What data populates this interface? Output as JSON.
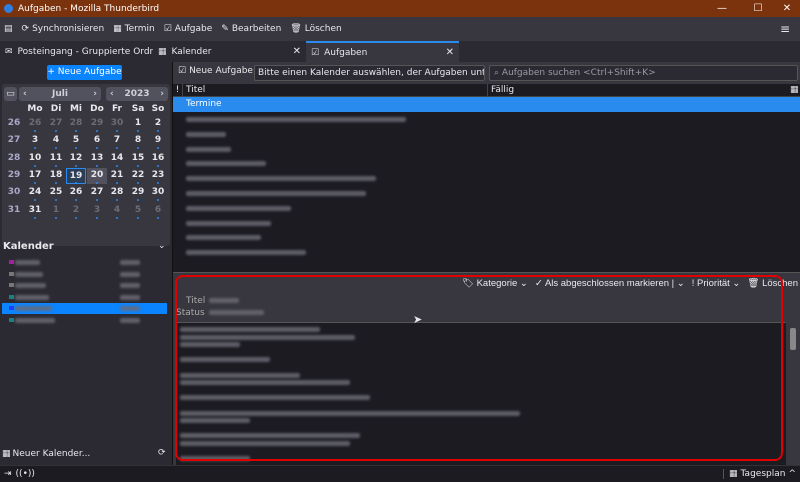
{
  "window": {
    "title": "Aufgaben - Mozilla Thunderbird",
    "minimize": "—",
    "maximize": "☐",
    "close": "✕"
  },
  "toolbar": {
    "sync": "Synchronisieren",
    "event": "Termin",
    "task": "Aufgabe",
    "edit": "Bearbeiten",
    "delete": "Löschen",
    "menu": "≡"
  },
  "tabs": [
    {
      "label": "Posteingang - Gruppierte Ordne"
    },
    {
      "label": "Kalender"
    },
    {
      "label": "Aufgaben"
    }
  ],
  "left": {
    "new_task": "+ Neue Aufgabe",
    "month": "Juli",
    "year": "2023",
    "weekdays": [
      "Mo",
      "Di",
      "Mi",
      "Do",
      "Fr",
      "Sa",
      "So"
    ],
    "weeks": [
      {
        "wk": "26",
        "days": [
          "26",
          "27",
          "28",
          "29",
          "30",
          "1",
          "2"
        ]
      },
      {
        "wk": "27",
        "days": [
          "3",
          "4",
          "5",
          "6",
          "7",
          "8",
          "9"
        ]
      },
      {
        "wk": "28",
        "days": [
          "10",
          "11",
          "12",
          "13",
          "14",
          "15",
          "16"
        ]
      },
      {
        "wk": "29",
        "days": [
          "17",
          "18",
          "19",
          "20",
          "21",
          "22",
          "23"
        ]
      },
      {
        "wk": "30",
        "days": [
          "24",
          "25",
          "26",
          "27",
          "28",
          "29",
          "30"
        ]
      },
      {
        "wk": "31",
        "days": [
          "31",
          "1",
          "2",
          "3",
          "4",
          "5",
          "6"
        ]
      }
    ],
    "today": "19",
    "selected": "20",
    "calendars_heading": "Kalender",
    "new_calendar": "Neuer Kalender..."
  },
  "tasks": {
    "new_task": "Neue Aufgabe",
    "calendar_hint": "Bitte einen Kalender auswählen, der Aufgaben unterstü",
    "search_placeholder": "Aufgaben suchen <Ctrl+Shift+K>",
    "col_priority": "!",
    "col_title": "Titel",
    "col_due": "Fällig",
    "group": "Termine"
  },
  "details": {
    "category": "Kategorie",
    "mark_done": "Als abgeschlossen markieren",
    "priority": "Priorität",
    "delete": "Löschen",
    "title_label": "Titel",
    "status_label": "Status"
  },
  "statusbar": {
    "today_pane": "Tagesplan"
  },
  "colors": {
    "accent": "#0a84ff",
    "highlight": "#2a8bef",
    "titlebar": "#7a330c",
    "annotation": "#e00000"
  }
}
